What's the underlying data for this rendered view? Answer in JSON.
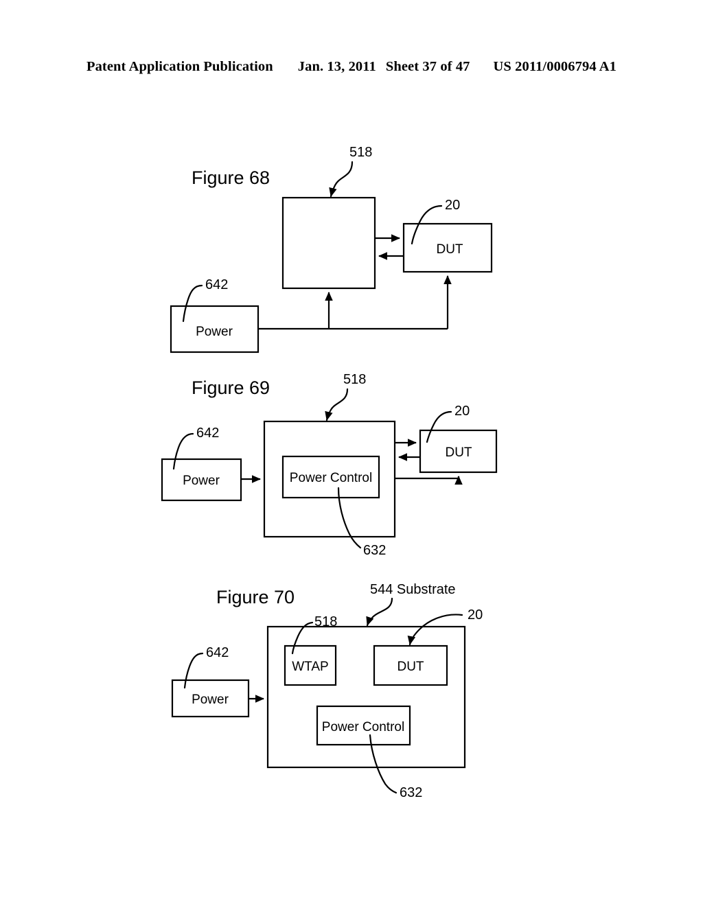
{
  "header": {
    "publication": "Patent Application Publication",
    "date": "Jan. 13, 2011",
    "sheet": "Sheet 37 of 47",
    "patent_number": "US 2011/0006794 A1"
  },
  "figures": [
    {
      "id": "figure-68",
      "title": "Figure 68",
      "boxes": [
        {
          "name": "wtap-block",
          "label": "",
          "ref": "518"
        },
        {
          "name": "dut-block",
          "label": "DUT",
          "ref": "20"
        },
        {
          "name": "power-block",
          "label": "Power",
          "ref": "642"
        }
      ],
      "refs": [
        "518",
        "20",
        "642"
      ]
    },
    {
      "id": "figure-69",
      "title": "Figure 69",
      "boxes": [
        {
          "name": "wtap-block",
          "label": "",
          "ref": "518"
        },
        {
          "name": "power-control-block",
          "label": "Power Control",
          "ref": "632"
        },
        {
          "name": "dut-block",
          "label": "DUT",
          "ref": "20"
        },
        {
          "name": "power-block",
          "label": "Power",
          "ref": "642"
        }
      ],
      "refs": [
        "518",
        "20",
        "642",
        "632"
      ]
    },
    {
      "id": "figure-70",
      "title": "Figure 70",
      "boxes": [
        {
          "name": "substrate-block",
          "label": "",
          "ref": "544 Substrate"
        },
        {
          "name": "wtap-block",
          "label": "WTAP",
          "ref": "518"
        },
        {
          "name": "dut-block",
          "label": "DUT",
          "ref": "20"
        },
        {
          "name": "power-control-block",
          "label": "Power Control",
          "ref": "632"
        },
        {
          "name": "power-block",
          "label": "Power",
          "ref": "642"
        }
      ],
      "refs": [
        "518",
        "20",
        "642",
        "632",
        "544 Substrate"
      ]
    }
  ],
  "labels": {
    "fig68_title": "Figure 68",
    "fig68_ref_518": "518",
    "fig68_ref_20": "20",
    "fig68_ref_642": "642",
    "fig68_dut": "DUT",
    "fig68_power": "Power",
    "fig69_title": "Figure 69",
    "fig69_ref_518": "518",
    "fig69_ref_20": "20",
    "fig69_ref_642": "642",
    "fig69_ref_632": "632",
    "fig69_dut": "DUT",
    "fig69_power": "Power",
    "fig69_power_control": "Power Control",
    "fig70_title": "Figure 70",
    "fig70_ref_518": "518",
    "fig70_ref_20": "20",
    "fig70_ref_642": "642",
    "fig70_ref_632": "632",
    "fig70_ref_544": "544 Substrate",
    "fig70_wtap": "WTAP",
    "fig70_dut": "DUT",
    "fig70_power": "Power",
    "fig70_power_control": "Power Control"
  },
  "colors": {
    "ink": "#000000",
    "paper": "#ffffff"
  }
}
